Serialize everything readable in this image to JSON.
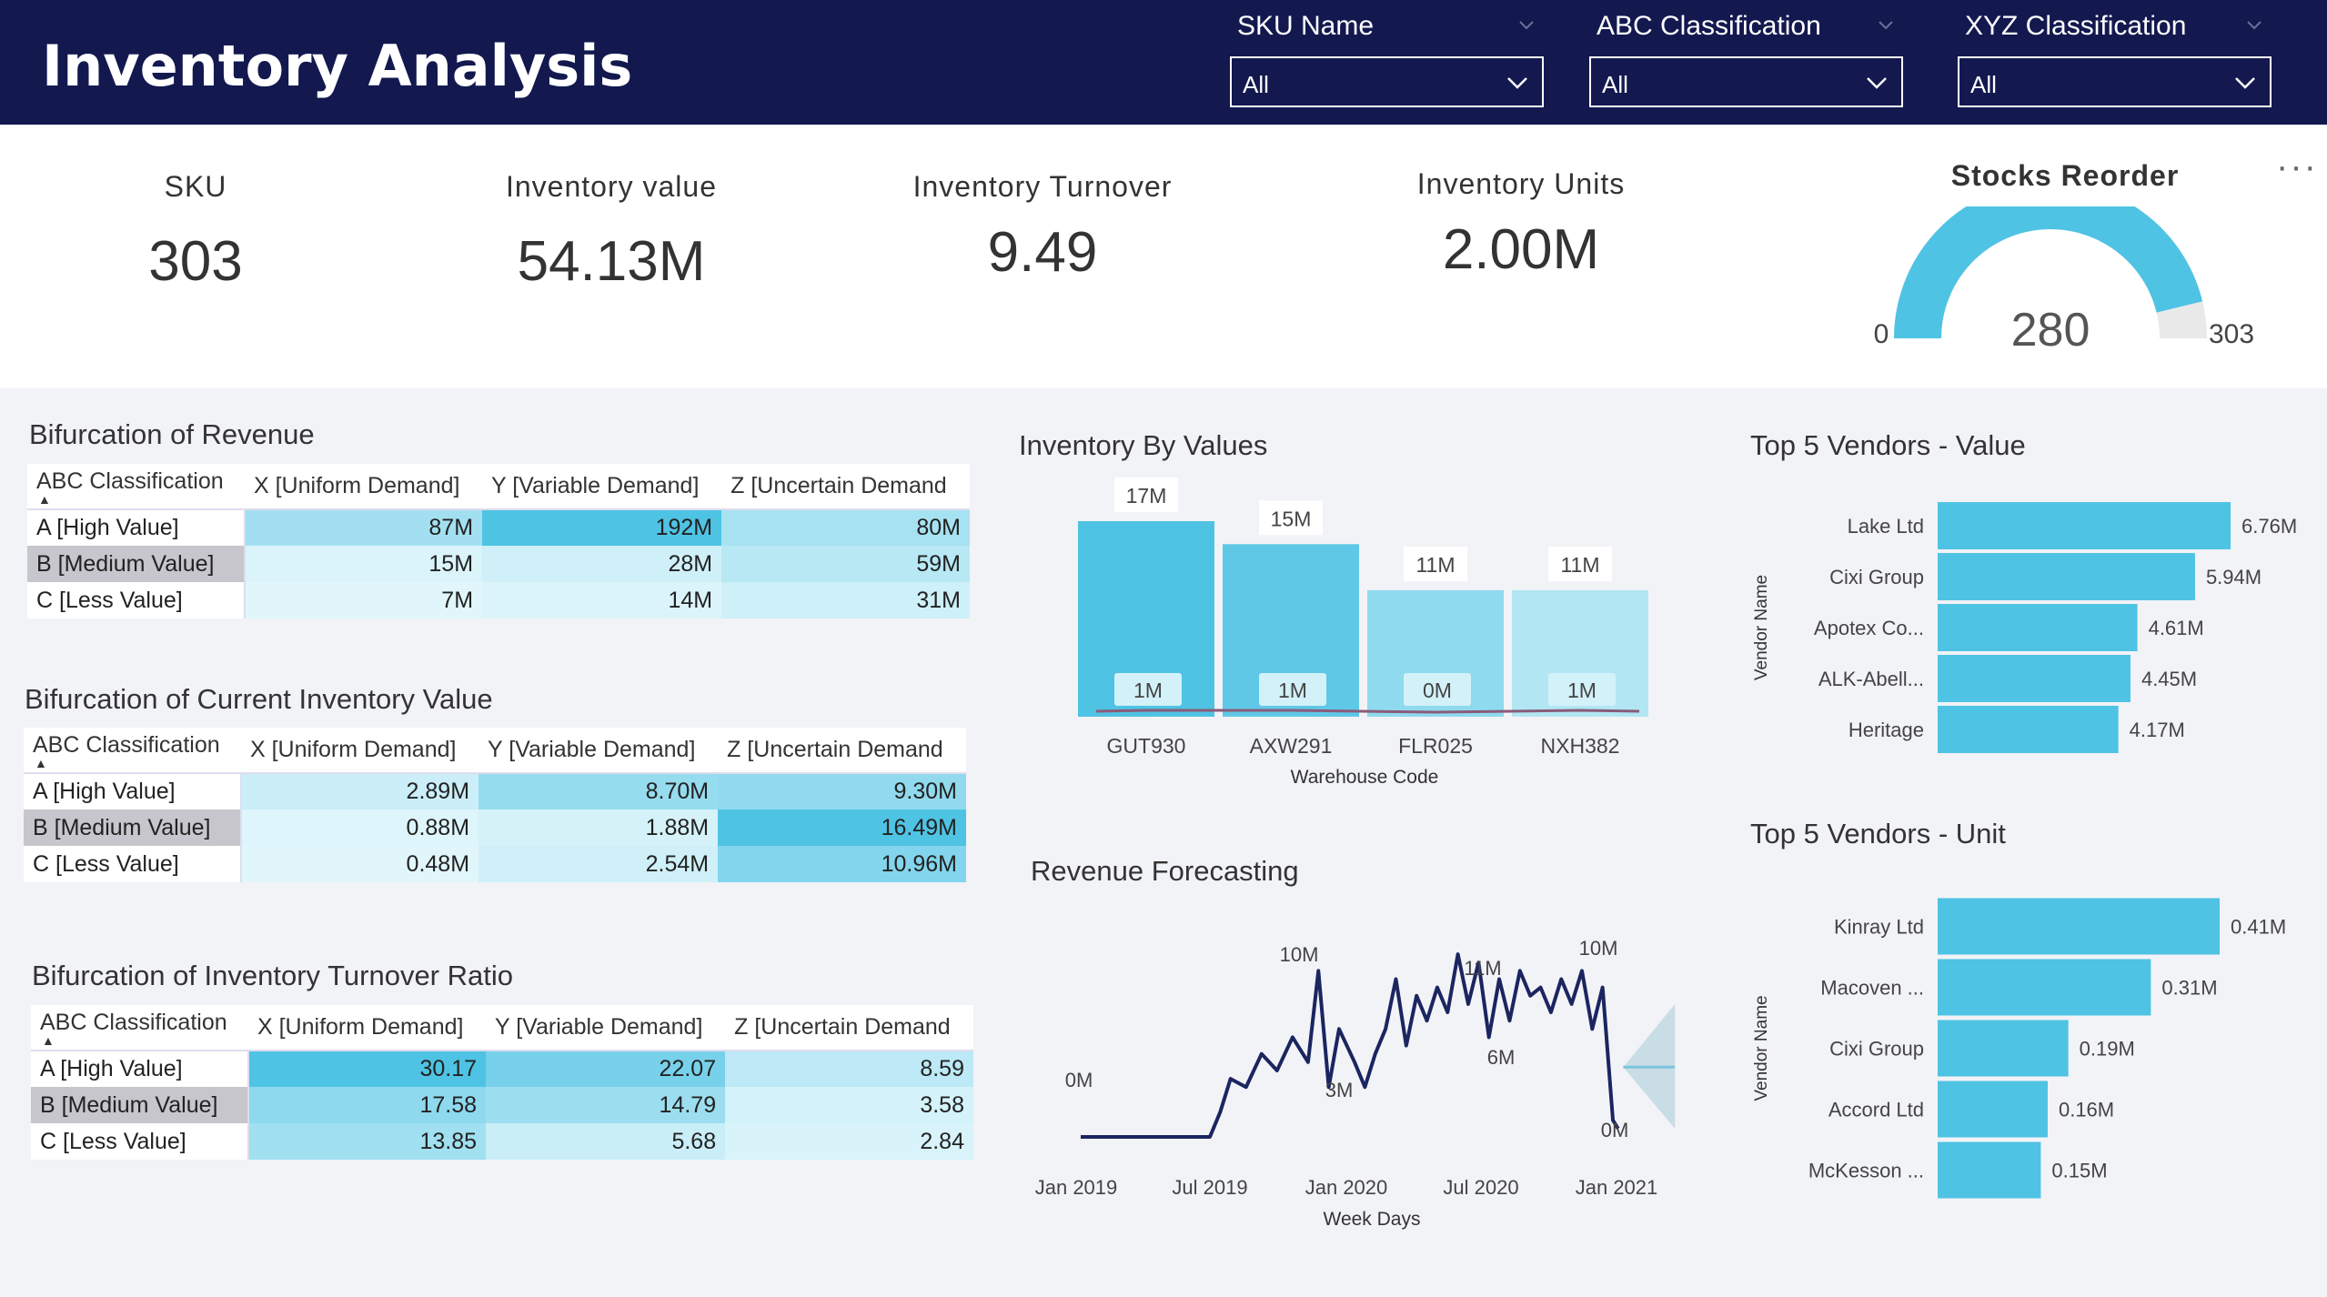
{
  "header": {
    "title": "Inventory Analysis",
    "slicers": [
      {
        "label": "SKU Name",
        "value": "All"
      },
      {
        "label": "ABC Classification",
        "value": "All"
      },
      {
        "label": "XYZ Classification",
        "value": "All"
      }
    ]
  },
  "kpis": {
    "sku": {
      "label": "SKU",
      "value": "303"
    },
    "inventory_value": {
      "label": "Inventory value",
      "value": "54.13M"
    },
    "inventory_turnover": {
      "label": "Inventory Turnover",
      "value": "9.49"
    },
    "inventory_units": {
      "label": "Inventory Units",
      "value": "2.00M"
    },
    "stocks_reorder": {
      "label": "Stocks Reorder",
      "value": "280",
      "min": "0",
      "max": "303",
      "fraction": 0.924
    }
  },
  "colors": {
    "header": "#13194f",
    "accent": "#4fc3e3",
    "selected_row": "#c6c6cc",
    "line": "#1b2560"
  },
  "matrices": {
    "revenue": {
      "title": "Bifurcation of Revenue",
      "headers": [
        "ABC Classification",
        "X [Uniform Demand]",
        "Y [Variable Demand]",
        "Z [Uncertain Demand"
      ],
      "rows": [
        {
          "label": "A [High Value]",
          "values": [
            "87M",
            "192M",
            "80M"
          ],
          "levels": [
            0.45,
            1.0,
            0.42
          ]
        },
        {
          "label": "B [Medium Value]",
          "values": [
            "15M",
            "28M",
            "59M"
          ],
          "levels": [
            0.08,
            0.15,
            0.31
          ]
        },
        {
          "label": "C [Less Value]",
          "values": [
            "7M",
            "14M",
            "31M"
          ],
          "levels": [
            0.04,
            0.07,
            0.16
          ]
        }
      ]
    },
    "inventory_value": {
      "title": "Bifurcation of Current Inventory Value",
      "headers": [
        "ABC Classification",
        "X [Uniform Demand]",
        "Y [Variable Demand]",
        "Z [Uncertain Demand"
      ],
      "rows": [
        {
          "label": "A [High Value]",
          "values": [
            "2.89M",
            "8.70M",
            "9.30M"
          ],
          "levels": [
            0.18,
            0.53,
            0.56
          ]
        },
        {
          "label": "B [Medium Value]",
          "values": [
            "0.88M",
            "1.88M",
            "16.49M"
          ],
          "levels": [
            0.05,
            0.11,
            1.0
          ]
        },
        {
          "label": "C [Less Value]",
          "values": [
            "0.48M",
            "2.54M",
            "10.96M"
          ],
          "levels": [
            0.03,
            0.15,
            0.66
          ]
        }
      ]
    },
    "turnover": {
      "title": "Bifurcation of Inventory Turnover Ratio",
      "headers": [
        "ABC Classification",
        "X [Uniform Demand]",
        "Y [Variable Demand]",
        "Z [Uncertain Demand"
      ],
      "rows": [
        {
          "label": "A [High Value]",
          "values": [
            "30.17",
            "22.07",
            "8.59"
          ],
          "levels": [
            1.0,
            0.73,
            0.28
          ]
        },
        {
          "label": "B [Medium Value]",
          "values": [
            "17.58",
            "14.79",
            "3.58"
          ],
          "levels": [
            0.58,
            0.49,
            0.12
          ]
        },
        {
          "label": "C [Less Value]",
          "values": [
            "13.85",
            "5.68",
            "2.84"
          ],
          "levels": [
            0.46,
            0.19,
            0.09
          ]
        }
      ]
    }
  },
  "chart_data": [
    {
      "type": "bar",
      "title": "Inventory By Values",
      "xlabel": "Warehouse Code",
      "categories": [
        "GUT930",
        "AXW291",
        "FLR025",
        "NXH382"
      ],
      "series": [
        {
          "values": [
            17,
            15,
            11,
            11
          ],
          "labels": [
            "17M",
            "15M",
            "11M",
            "11M"
          ]
        },
        {
          "values": [
            1,
            1,
            0,
            1
          ],
          "labels": [
            "1M",
            "1M",
            "0M",
            "1M"
          ]
        }
      ]
    },
    {
      "type": "line",
      "title": "Revenue Forecasting",
      "xlabel": "Week Days",
      "x_ticks": [
        "Jan 2019",
        "Jul 2019",
        "Jan 2020",
        "Jul 2020",
        "Jan 2021"
      ],
      "data_labels": [
        "0M",
        "10M",
        "3M",
        "11M",
        "6M",
        "10M",
        "0M"
      ],
      "x_range": [
        "2018-12-15",
        "2021-04-01"
      ],
      "y_range": [
        0,
        11.5
      ],
      "values": [
        [
          "2018-12-31",
          0
        ],
        [
          "2019-06-24",
          0
        ],
        [
          "2019-07-08",
          1.5
        ],
        [
          "2019-07-22",
          3.5
        ],
        [
          "2019-08-12",
          3.0
        ],
        [
          "2019-09-02",
          5.0
        ],
        [
          "2019-09-23",
          4.0
        ],
        [
          "2019-10-14",
          6.0
        ],
        [
          "2019-11-04",
          4.5
        ],
        [
          "2019-11-18",
          10.0
        ],
        [
          "2019-12-02",
          3.0
        ],
        [
          "2019-12-16",
          6.5
        ],
        [
          "2020-01-06",
          4.5
        ],
        [
          "2020-01-20",
          3.0
        ],
        [
          "2020-02-03",
          5.0
        ],
        [
          "2020-02-17",
          6.5
        ],
        [
          "2020-03-02",
          9.5
        ],
        [
          "2020-03-16",
          5.5
        ],
        [
          "2020-03-30",
          8.5
        ],
        [
          "2020-04-13",
          7.0
        ],
        [
          "2020-04-27",
          9.0
        ],
        [
          "2020-05-11",
          7.5
        ],
        [
          "2020-05-25",
          11.0
        ],
        [
          "2020-06-08",
          8.0
        ],
        [
          "2020-06-22",
          10.5
        ],
        [
          "2020-07-06",
          6.0
        ],
        [
          "2020-07-20",
          9.5
        ],
        [
          "2020-08-03",
          7.0
        ],
        [
          "2020-08-17",
          10.0
        ],
        [
          "2020-08-31",
          8.5
        ],
        [
          "2020-09-14",
          9.0
        ],
        [
          "2020-09-28",
          7.5
        ],
        [
          "2020-10-12",
          9.5
        ],
        [
          "2020-10-26",
          8.0
        ],
        [
          "2020-11-09",
          10.0
        ],
        [
          "2020-11-23",
          6.5
        ],
        [
          "2020-12-07",
          9.0
        ],
        [
          "2020-12-21",
          1.0
        ],
        [
          "2020-12-28",
          0.5
        ]
      ],
      "forecast": {
        "start": "2021-01-04",
        "end": "2021-03-15",
        "mid": 4.2,
        "low": 0.5,
        "high": 8.0
      }
    },
    {
      "type": "bar",
      "orientation": "horizontal",
      "title": "Top 5 Vendors - Value",
      "ylabel": "Vendor Name",
      "categories": [
        "Lake Ltd",
        "Cixi Group",
        "Apotex Co...",
        "ALK-Abell...",
        "Heritage"
      ],
      "values": [
        6.76,
        5.94,
        4.61,
        4.45,
        4.17
      ],
      "labels": [
        "6.76M",
        "5.94M",
        "4.61M",
        "4.45M",
        "4.17M"
      ]
    },
    {
      "type": "bar",
      "orientation": "horizontal",
      "title": "Top 5 Vendors - Unit",
      "ylabel": "Vendor Name",
      "categories": [
        "Kinray Ltd",
        "Macoven ...",
        "Cixi Group",
        "Accord Ltd",
        "McKesson ..."
      ],
      "values": [
        0.41,
        0.31,
        0.19,
        0.16,
        0.15
      ],
      "labels": [
        "0.41M",
        "0.31M",
        "0.19M",
        "0.16M",
        "0.15M"
      ]
    }
  ]
}
